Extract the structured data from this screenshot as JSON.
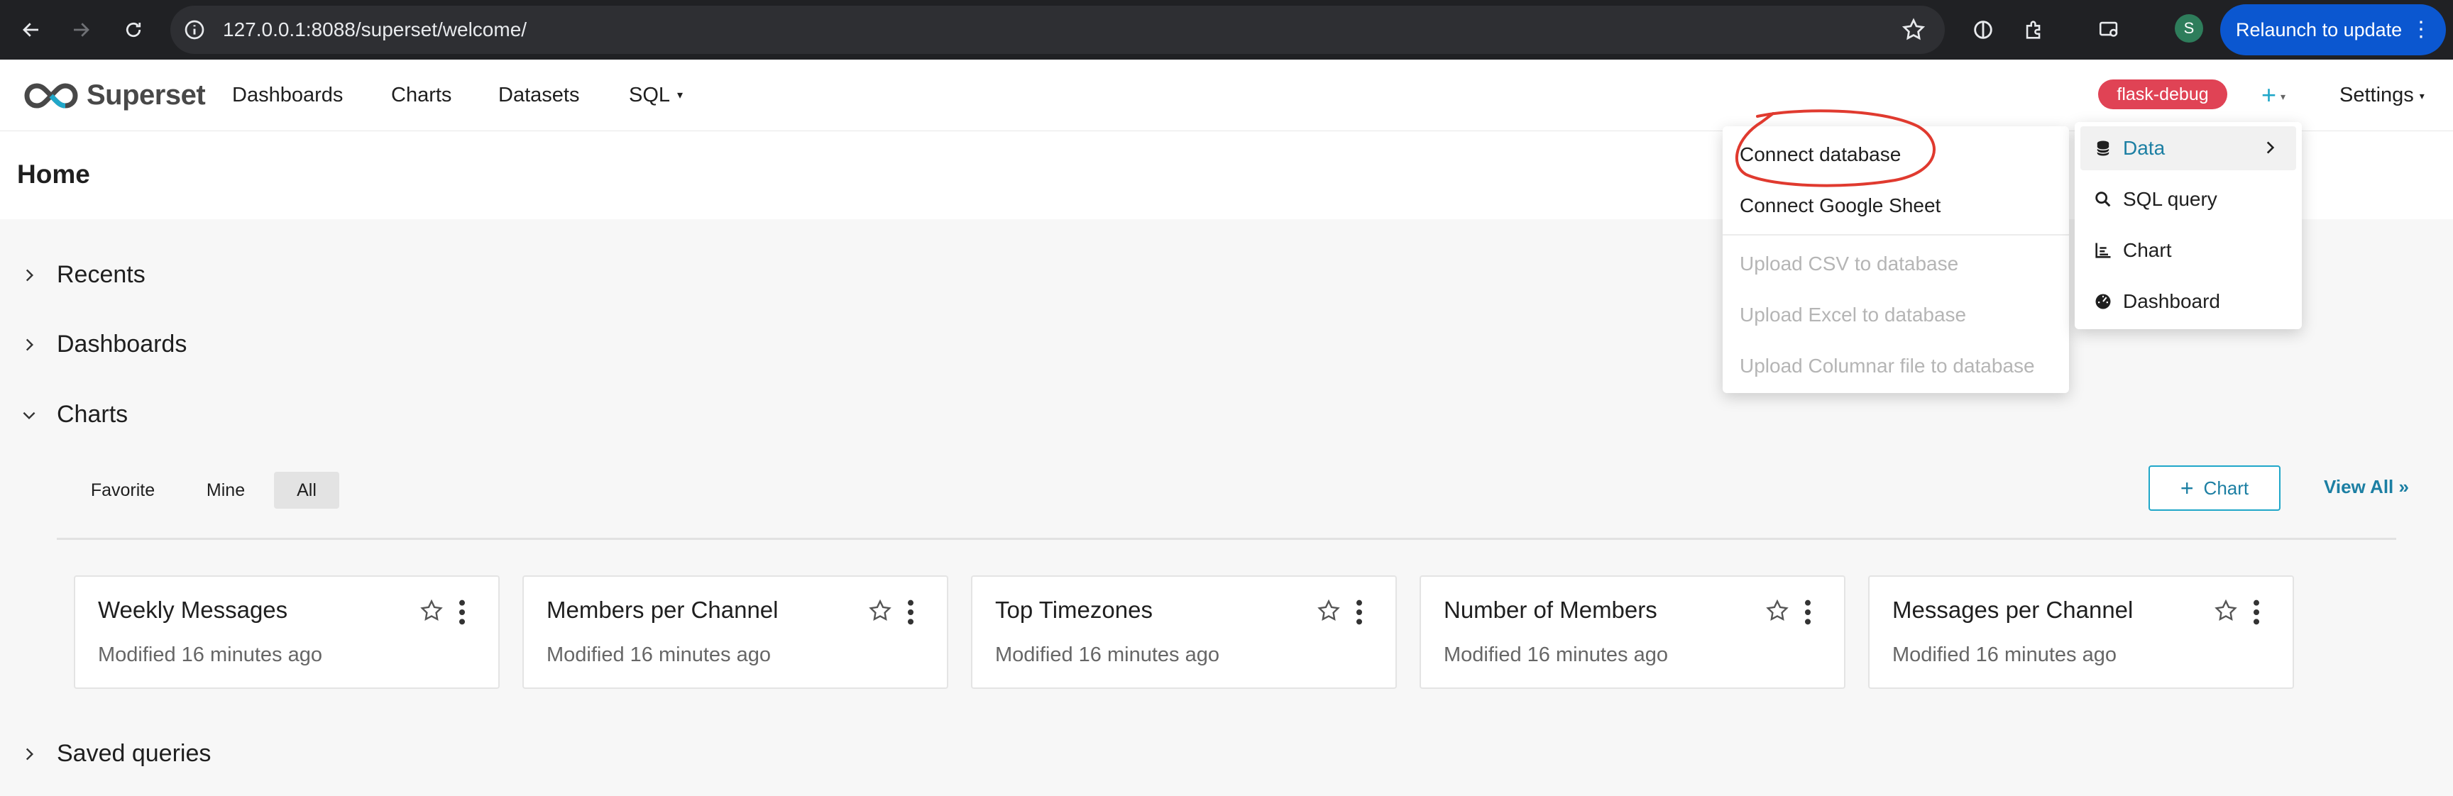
{
  "browser": {
    "url": "127.0.0.1:8088/superset/welcome/",
    "profile_initial": "S",
    "relaunch_label": "Relaunch to update"
  },
  "header": {
    "brand": "Superset",
    "menu": [
      {
        "label": "Dashboards"
      },
      {
        "label": "Charts"
      },
      {
        "label": "Datasets"
      },
      {
        "label": "SQL"
      }
    ],
    "env_badge": "flask-debug",
    "plus_label": "+",
    "settings_label": "Settings",
    "accent_color": "#20a7c9"
  },
  "page": {
    "title": "Home"
  },
  "sections": {
    "recents": "Recents",
    "dashboards": "Dashboards",
    "charts": "Charts",
    "saved_queries": "Saved queries"
  },
  "charts_panel": {
    "tabs": [
      {
        "label": "Favorite",
        "active": false
      },
      {
        "label": "Mine",
        "active": false
      },
      {
        "label": "All",
        "active": true
      }
    ],
    "add_button": "Chart",
    "view_all": "View All »",
    "cards": [
      {
        "title": "Weekly Messages",
        "modified": "Modified 16 minutes ago"
      },
      {
        "title": "Members per Channel",
        "modified": "Modified 16 minutes ago"
      },
      {
        "title": "Top Timezones",
        "modified": "Modified 16 minutes ago"
      },
      {
        "title": "Number of Members",
        "modified": "Modified 16 minutes ago"
      },
      {
        "title": "Messages per Channel",
        "modified": "Modified 16 minutes ago"
      }
    ]
  },
  "new_menu": {
    "items": [
      {
        "label": "Data",
        "icon": "database-icon",
        "active": true
      },
      {
        "label": "SQL query",
        "icon": "search-icon"
      },
      {
        "label": "Chart",
        "icon": "bar-chart-icon"
      },
      {
        "label": "Dashboard",
        "icon": "dashboard-icon"
      }
    ]
  },
  "data_submenu": {
    "items": [
      {
        "label": "Connect database",
        "disabled": false
      },
      {
        "label": "Connect Google Sheet",
        "disabled": false
      },
      {
        "label": "Upload CSV to database",
        "disabled": true
      },
      {
        "label": "Upload Excel to database",
        "disabled": true
      },
      {
        "label": "Upload Columnar file to database",
        "disabled": true
      }
    ],
    "annotation_color": "#e03a2f"
  }
}
